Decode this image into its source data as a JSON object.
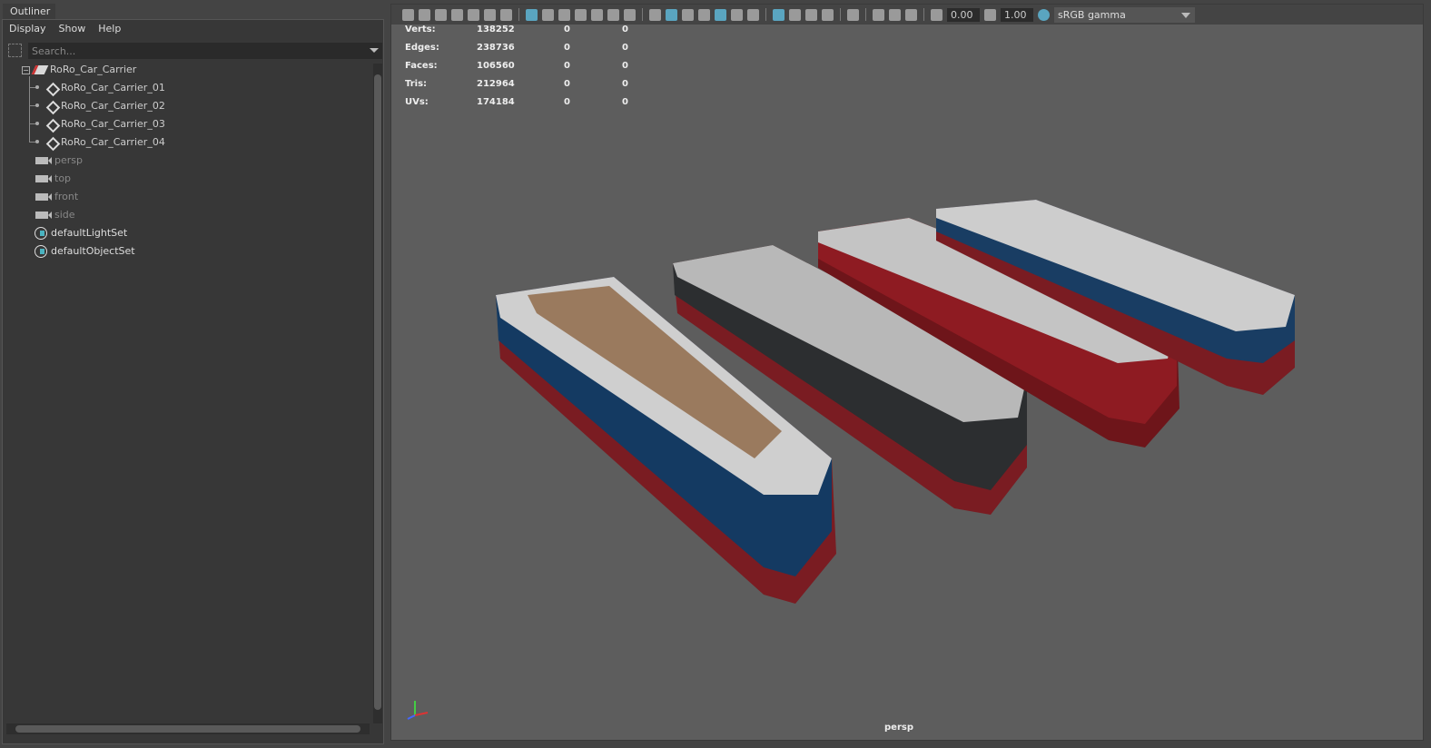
{
  "outliner": {
    "tab": "Outliner",
    "menu": [
      "Display",
      "Show",
      "Help"
    ],
    "search_placeholder": "Search...",
    "root": "RoRo_Car_Carrier",
    "children": [
      "RoRo_Car_Carrier_01",
      "RoRo_Car_Carrier_02",
      "RoRo_Car_Carrier_03",
      "RoRo_Car_Carrier_04"
    ],
    "cameras": [
      "persp",
      "top",
      "front",
      "side"
    ],
    "sets": [
      "defaultLightSet",
      "defaultObjectSet"
    ]
  },
  "viewport": {
    "exposure": "0.00",
    "gamma_value": "1.00",
    "color_space": "sRGB gamma",
    "camera": "persp",
    "stats": [
      {
        "label": "Verts:",
        "value": "138252",
        "sel": "0",
        "comp": "0"
      },
      {
        "label": "Edges:",
        "value": "238736",
        "sel": "0",
        "comp": "0"
      },
      {
        "label": "Faces:",
        "value": "106560",
        "sel": "0",
        "comp": "0"
      },
      {
        "label": "Tris:",
        "value": "212964",
        "sel": "0",
        "comp": "0"
      },
      {
        "label": "UVs:",
        "value": "174184",
        "sel": "0",
        "comp": "0"
      }
    ]
  }
}
